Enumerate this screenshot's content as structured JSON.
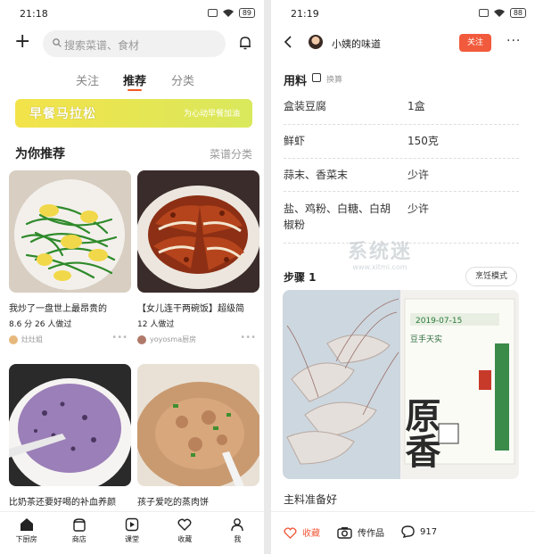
{
  "left": {
    "status": {
      "time": "21:18",
      "battery": "89"
    },
    "search": {
      "placeholder": "搜索菜谱、食材"
    },
    "tabs": [
      "关注",
      "推荐",
      "分类"
    ],
    "active_tab": "推荐",
    "banner": {
      "title": "早餐马拉松",
      "subtitle": "为心动早餐加油"
    },
    "section": {
      "title": "为你推荐",
      "link": "菜谱分类"
    },
    "cards": [
      {
        "title": "我炒了一盘世上最昂贵的",
        "meta": "8.6 分 26 人做过",
        "author": "灶灶姐"
      },
      {
        "title": "【女儿连干两碗饭】超级简",
        "meta": "12 人做过",
        "author": "yoyosma厨房"
      },
      {
        "title": "比奶茶还要好喝的补血养颜",
        "meta": "",
        "author": ""
      },
      {
        "title": "孩子爱吃的蒸肉饼",
        "meta": "",
        "author": ""
      }
    ],
    "tabbar": [
      {
        "label": "下厨房",
        "icon": "home-icon"
      },
      {
        "label": "商店",
        "icon": "store-icon"
      },
      {
        "label": "课堂",
        "icon": "play-icon"
      },
      {
        "label": "收藏",
        "icon": "heart-icon"
      },
      {
        "label": "我",
        "icon": "user-icon"
      }
    ],
    "colors": {
      "accent": "#f15a24",
      "banner": "#e8e34e"
    }
  },
  "right": {
    "status": {
      "time": "21:19",
      "battery": "88"
    },
    "header": {
      "author": "小姨的味道",
      "follow": "关注"
    },
    "ingredients": {
      "title": "用料",
      "scale_label": "换算",
      "items": [
        {
          "name": "盒装豆腐",
          "qty": "1盒"
        },
        {
          "name": "鲜虾",
          "qty": "150克"
        },
        {
          "name": "蒜末、香菜末",
          "qty": "少许"
        },
        {
          "name": "盐、鸡粉、白糖、白胡椒粉",
          "qty": "少许"
        }
      ]
    },
    "watermark": {
      "main": "系统迷",
      "sub": "www.xitmi.com"
    },
    "step": {
      "title": "步骤 1",
      "cook_mode": "烹饪模式",
      "caption": "主料准备好",
      "package_text": "原香",
      "package_brand": "豆手天实",
      "package_date": "2019-07-15"
    },
    "actions": {
      "fav": "收藏",
      "upload": "传作品",
      "comments": "917"
    },
    "colors": {
      "follow": "#f15a3c"
    }
  }
}
